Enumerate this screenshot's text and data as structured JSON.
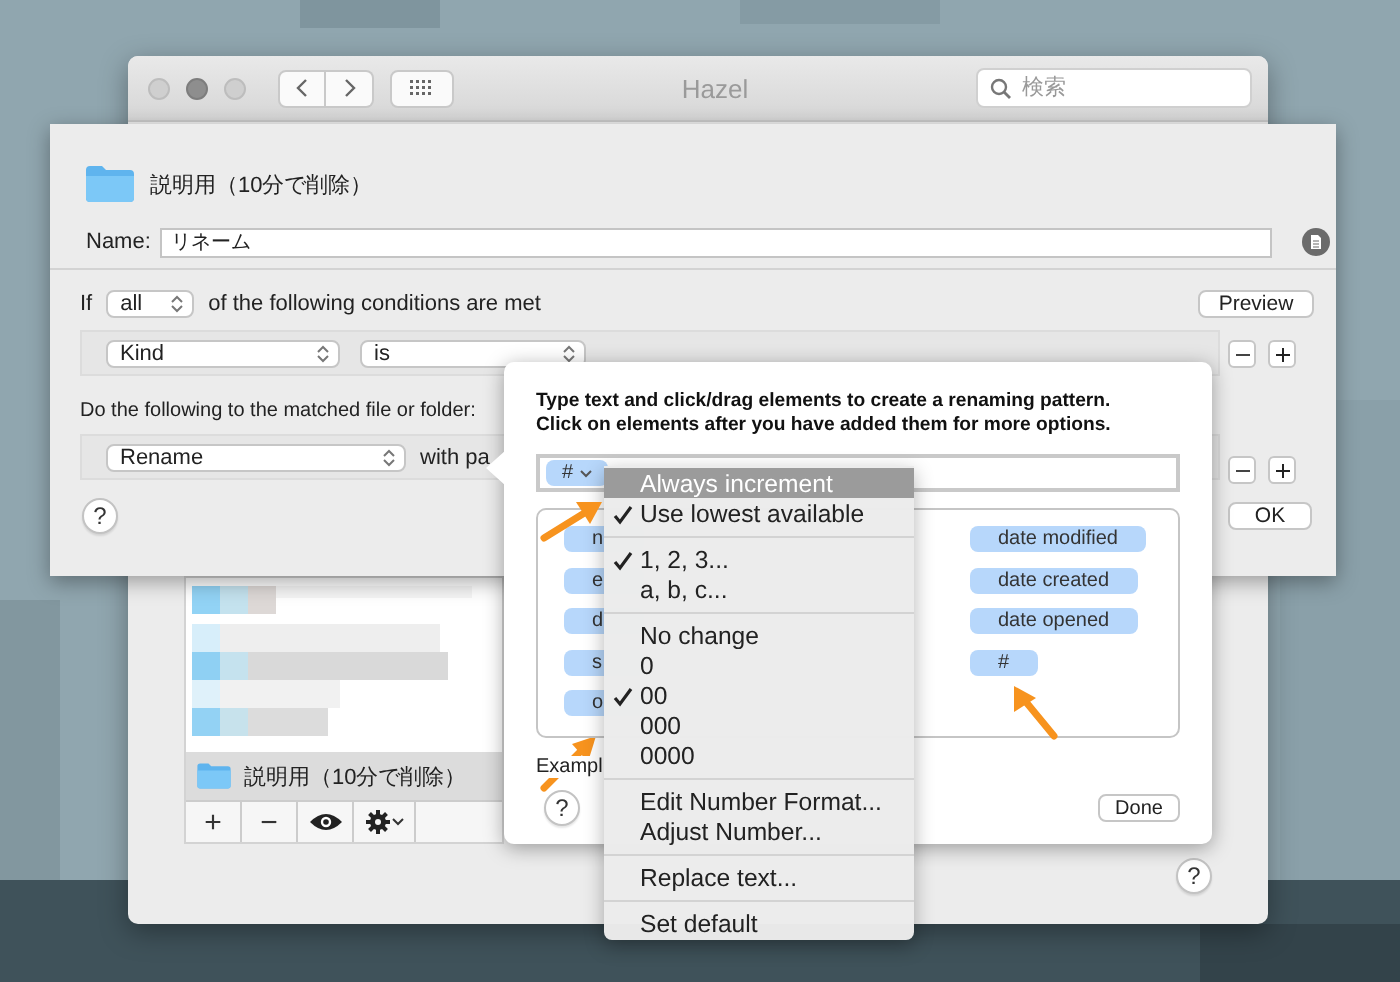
{
  "window": {
    "title": "Hazel",
    "search": {
      "placeholder": "検索"
    }
  },
  "folder_list": {
    "selected_folder": "説明用（10分で削除）",
    "toolbar": [
      "+",
      "−"
    ],
    "help": "?"
  },
  "rule": {
    "folder": "説明用（10分で削除）",
    "name_label": "Name:",
    "name": "リネーム",
    "condition_prefix": "If",
    "match": "all",
    "condition_suffix": "of the following conditions are met",
    "preview": "Preview",
    "conditions": [
      {
        "attribute": "Kind",
        "operator": "is"
      }
    ],
    "actions_label": "Do the following to the matched file or folder:",
    "actions": [
      {
        "action": "Rename",
        "with": "with pa"
      }
    ],
    "help": "?",
    "ok": "OK"
  },
  "popover": {
    "instructions": [
      "Type text and click/drag elements to create a renaming pattern.",
      "Click on elements after you have added them for more options."
    ],
    "pattern": [
      {
        "label": "#"
      }
    ],
    "elements_left": [
      "n",
      "e",
      "d",
      "s",
      "o"
    ],
    "elements_right": [
      "date modified",
      "date created",
      "date opened",
      "#"
    ],
    "example": "Exampl",
    "help": "?",
    "done": "Done"
  },
  "menu": {
    "items": [
      {
        "kind": "item",
        "label": "Always increment",
        "checked": false,
        "selected": true
      },
      {
        "kind": "item",
        "label": "Use lowest available",
        "checked": true,
        "selected": false
      },
      {
        "kind": "separator"
      },
      {
        "kind": "item",
        "label": "1, 2, 3...",
        "checked": true,
        "selected": false
      },
      {
        "kind": "item",
        "label": "a, b, c...",
        "checked": false,
        "selected": false
      },
      {
        "kind": "separator"
      },
      {
        "kind": "item",
        "label": "No change",
        "checked": false,
        "selected": false
      },
      {
        "kind": "item",
        "label": "0",
        "checked": false,
        "selected": false
      },
      {
        "kind": "item",
        "label": "00",
        "checked": true,
        "selected": false
      },
      {
        "kind": "item",
        "label": "000",
        "checked": false,
        "selected": false
      },
      {
        "kind": "item",
        "label": "0000",
        "checked": false,
        "selected": false
      },
      {
        "kind": "separator"
      },
      {
        "kind": "item",
        "label": "Edit Number Format...",
        "checked": false,
        "selected": false
      },
      {
        "kind": "item",
        "label": "Adjust Number...",
        "checked": false,
        "selected": false
      },
      {
        "kind": "separator"
      },
      {
        "kind": "item",
        "label": "Replace text...",
        "checked": false,
        "selected": false
      },
      {
        "kind": "separator"
      },
      {
        "kind": "item",
        "label": "Set default",
        "checked": false,
        "selected": false
      }
    ]
  }
}
